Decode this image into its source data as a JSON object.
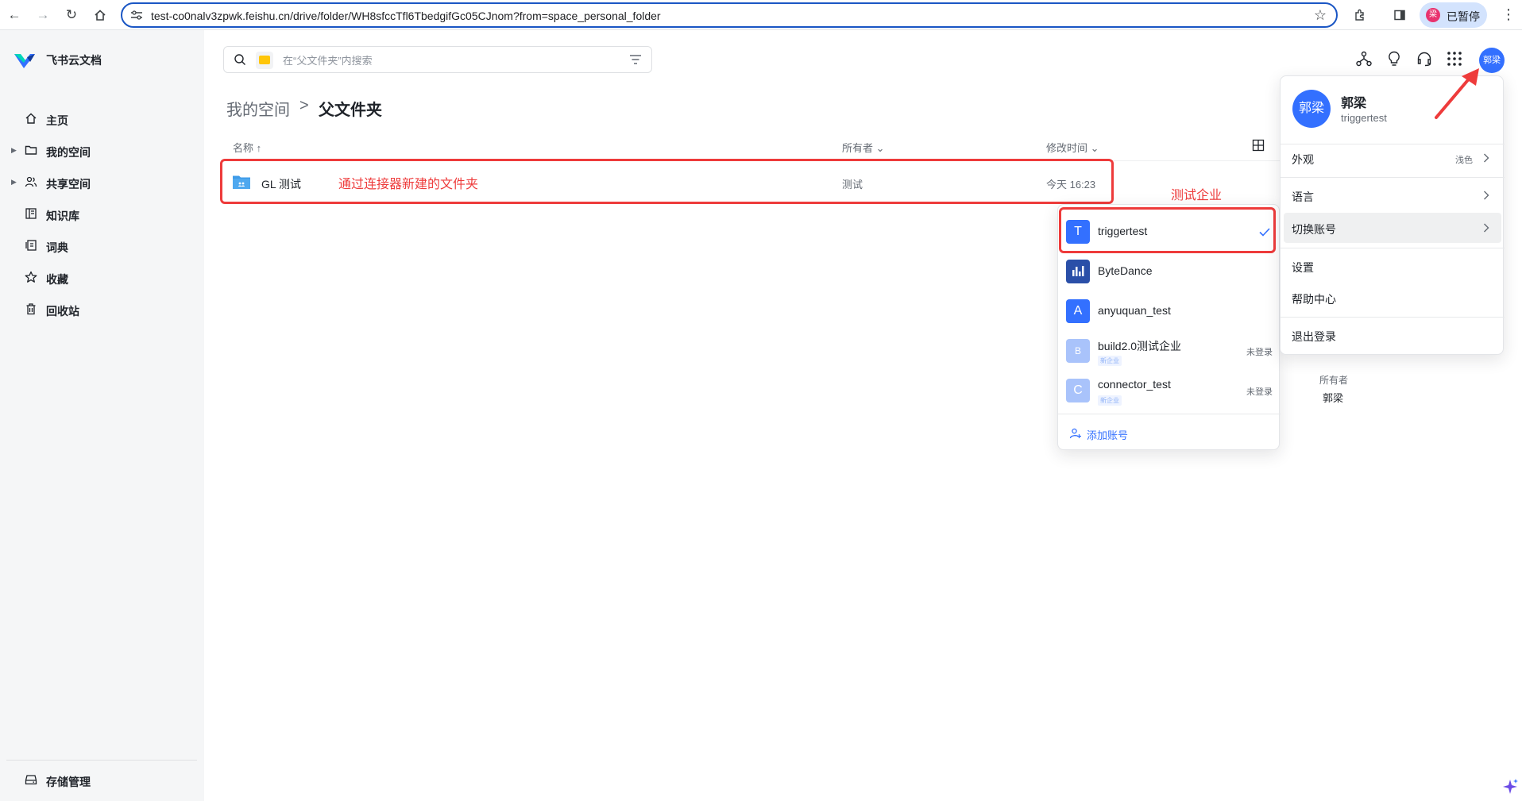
{
  "browser": {
    "url": "test-co0nalv3zpwk.feishu.cn/drive/folder/WH8sfccTfl6TbedgifGc05CJnom?from=space_personal_folder",
    "profile_initial": "梁",
    "profile_status": "已暂停"
  },
  "sidebar": {
    "brand": "飞书云文档",
    "items": [
      {
        "label": "主页",
        "icon": "home-icon"
      },
      {
        "label": "我的空间",
        "icon": "folder-icon"
      },
      {
        "label": "共享空间",
        "icon": "users-icon"
      },
      {
        "label": "知识库",
        "icon": "book-icon"
      },
      {
        "label": "词典",
        "icon": "dictionary-icon"
      },
      {
        "label": "收藏",
        "icon": "star-icon"
      },
      {
        "label": "回收站",
        "icon": "trash-icon"
      }
    ],
    "storage_label": "存储管理"
  },
  "search": {
    "placeholder": "在“父文件夹”内搜索"
  },
  "header": {
    "avatar_text": "郭梁"
  },
  "breadcrumb": {
    "root": "我的空间",
    "separator": ">",
    "current": "父文件夹"
  },
  "table": {
    "col_name": "名称 ↑",
    "col_owner": "所有者",
    "col_modified": "修改时间",
    "rows": [
      {
        "name": "GL 测试",
        "owner": "测试",
        "modified": "今天 16:23"
      }
    ]
  },
  "annotations": {
    "new_folder_note": "通过连接器新建的文件夹",
    "org_note": "测试企业"
  },
  "accounts": {
    "items": [
      {
        "initial": "T",
        "name": "triggertest",
        "color": "#3370ff",
        "status": "",
        "tag": ""
      },
      {
        "initial": "",
        "name": "ByteDance",
        "color": "#2a4fa8",
        "status": "",
        "tag": ""
      },
      {
        "initial": "A",
        "name": "anyuquan_test",
        "color": "#3370ff",
        "status": "",
        "tag": ""
      },
      {
        "initial": "B",
        "name": "build2.0测试企业",
        "color": "#a9c3fb",
        "status": "未登录",
        "tag": "新企业"
      },
      {
        "initial": "C",
        "name": "connector_test",
        "color": "#a9c3fb",
        "status": "未登录",
        "tag": "新企业"
      }
    ],
    "add_label": "添加账号"
  },
  "user_menu": {
    "avatar_text": "郭梁",
    "name": "郭梁",
    "username": "triggertest",
    "appearance": "外观",
    "appearance_value": "浅色",
    "language": "语言",
    "switch_account": "切换账号",
    "settings": "设置",
    "help": "帮助中心",
    "logout": "退出登录"
  },
  "details": {
    "owner_label": "所有者",
    "owner_value": "郭梁"
  }
}
